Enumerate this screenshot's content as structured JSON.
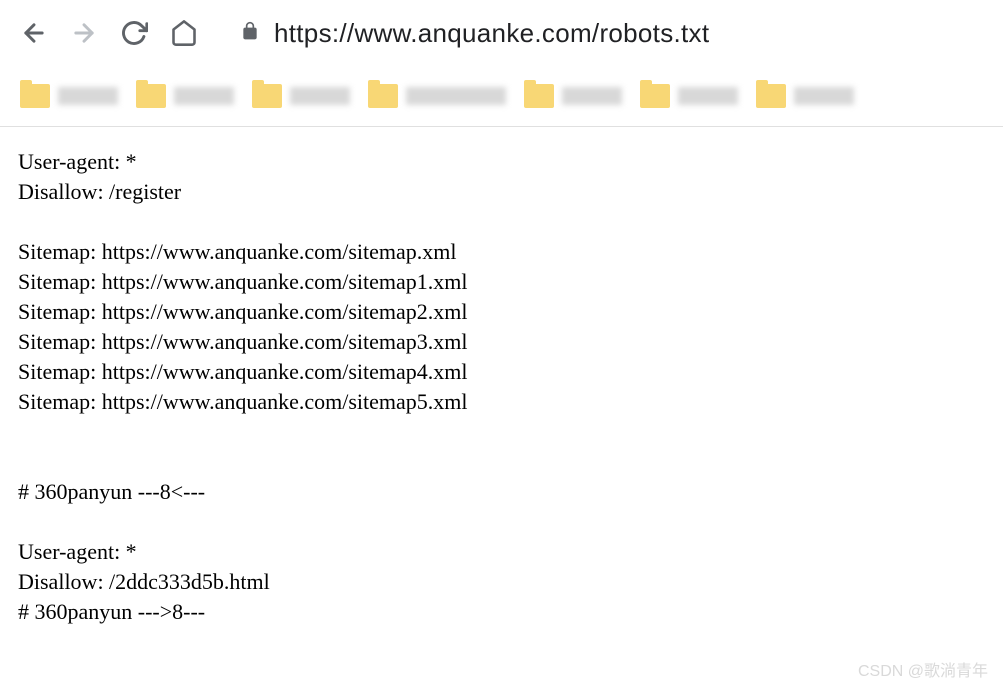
{
  "toolbar": {
    "url": "https://www.anquanke.com/robots.txt"
  },
  "content": {
    "lines": [
      "User-agent: *",
      "Disallow: /register",
      "",
      "Sitemap: https://www.anquanke.com/sitemap.xml",
      "Sitemap: https://www.anquanke.com/sitemap1.xml",
      "Sitemap: https://www.anquanke.com/sitemap2.xml",
      "Sitemap: https://www.anquanke.com/sitemap3.xml",
      "Sitemap: https://www.anquanke.com/sitemap4.xml",
      "Sitemap: https://www.anquanke.com/sitemap5.xml",
      "",
      "",
      "# 360panyun ---8<---",
      "",
      "User-agent: *",
      "Disallow: /2ddc333d5b.html",
      "# 360panyun --->8---"
    ]
  },
  "watermark": "CSDN @歌淌青年"
}
